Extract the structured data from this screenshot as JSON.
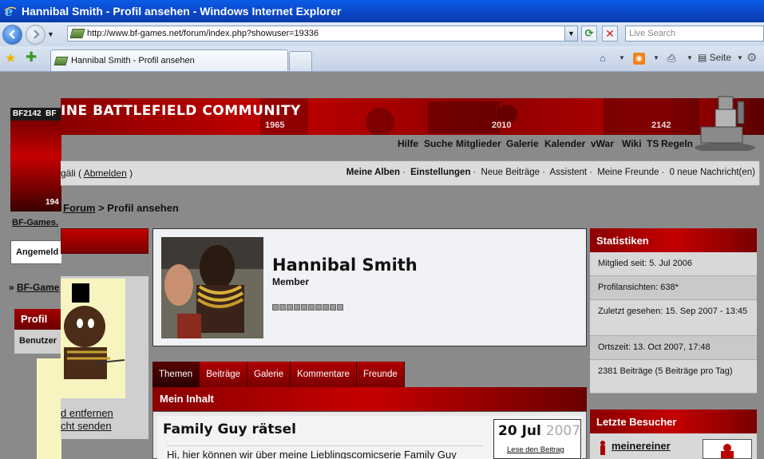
{
  "browser": {
    "window_title": "Hannibal Smith - Profil ansehen - Windows Internet Explorer",
    "url": "http://www.bf-games.net/forum/index.php?showuser=19336",
    "search_placeholder": "Live Search",
    "tab_title": "Hannibal Smith - Profil ansehen",
    "page_menu": "Seite"
  },
  "banner": {
    "title": "INE BATTLEFIELD COMMUNITY",
    "years": [
      "1965",
      "2010",
      "2142"
    ]
  },
  "topnav": [
    "Hilfe",
    "Suche",
    "Mitglieder",
    "Galerie",
    "Kalender",
    "vWar",
    "Wiki",
    "TS",
    "Regeln"
  ],
  "userbar": {
    "user_fragment": "gäli",
    "logout": "Abmelden",
    "links": [
      "Meine Alben",
      "Einstellungen",
      "Neue Beiträge",
      "Assistent",
      "Meine Freunde",
      "0 neue Nachricht(en)"
    ]
  },
  "breadcrumb": {
    "forum": "Forum",
    "separator": ">",
    "current": "Profil ansehen"
  },
  "left": {
    "bf2142": "BF2142",
    "bf_short": "BF",
    "year_fragment": "194",
    "site_link": "BF-Games.",
    "logged_in": "Angemeld",
    "nav_link": "BF-Game",
    "profile_header": "Profil",
    "user_label": "Benutzer",
    "link1": "d entfernen",
    "link2": "cht senden"
  },
  "profile": {
    "name": "Hannibal Smith",
    "rank": "Member"
  },
  "tabs": [
    "Themen",
    "Beiträge",
    "Galerie",
    "Kommentare",
    "Freunde"
  ],
  "content": {
    "header": "Mein Inhalt",
    "title": "Family Guy rätsel",
    "excerpt": "Hi, hier können wir über meine Lieblingscomicserie Family Guy",
    "date_day": "20 Jul",
    "date_year": "2007",
    "read_link": "Lese den Beitrag"
  },
  "stats": {
    "header": "Statistiken",
    "rows": [
      "Mitglied seit: 5. Jul 2006",
      "Profilansichten: 638*",
      "Zuletzt gesehen: 15. Sep 2007 - 13:45",
      "Ortszeit: 13. Oct 2007, 17:48",
      "2381 Beiträge (5 Beiträge pro Tag)"
    ]
  },
  "visitors": {
    "header": "Letzte Besucher",
    "first": "meinereiner"
  }
}
